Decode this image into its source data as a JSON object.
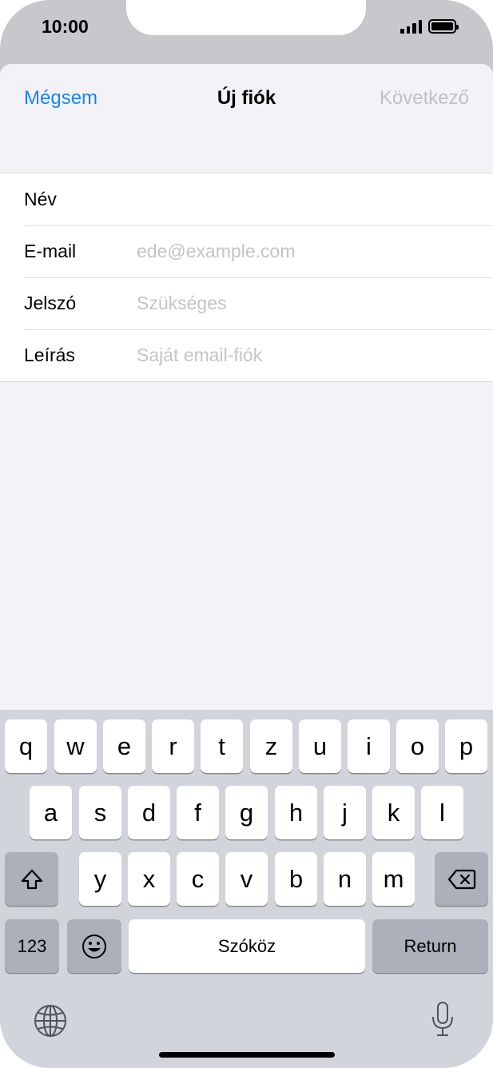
{
  "status_bar": {
    "time": "10:00"
  },
  "nav": {
    "cancel_label": "Mégsem",
    "title": "Új fiók",
    "next_label": "Következő"
  },
  "form": {
    "rows": [
      {
        "label": "Név",
        "placeholder": ""
      },
      {
        "label": "E-mail",
        "placeholder": "ede@example.com"
      },
      {
        "label": "Jelszó",
        "placeholder": "Szükséges"
      },
      {
        "label": "Leírás",
        "placeholder": "Saját email-fiók"
      }
    ]
  },
  "keyboard": {
    "row1": [
      "q",
      "w",
      "e",
      "r",
      "t",
      "z",
      "u",
      "i",
      "o",
      "p"
    ],
    "row2": [
      "a",
      "s",
      "d",
      "f",
      "g",
      "h",
      "j",
      "k",
      "l"
    ],
    "row3": [
      "y",
      "x",
      "c",
      "v",
      "b",
      "n",
      "m"
    ],
    "numbers_label": "123",
    "space_label": "Szóköz",
    "return_label": "Return"
  },
  "icons": {
    "shift": "shift-icon",
    "delete": "delete-icon",
    "emoji": "emoji-icon",
    "globe": "globe-icon",
    "microphone": "microphone-icon"
  },
  "colors": {
    "accent": "#1a84f0",
    "disabled": "#c0c0c5",
    "keyboard_bg": "#d1d4db"
  }
}
